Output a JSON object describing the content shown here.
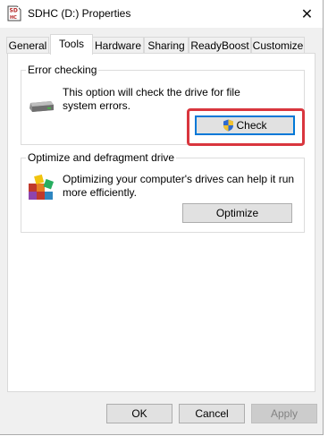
{
  "window": {
    "title": "SDHC (D:) Properties",
    "close_glyph": "✕",
    "icon": "sd-card-icon"
  },
  "tabs": [
    {
      "label": "General",
      "active": false
    },
    {
      "label": "Tools",
      "active": true
    },
    {
      "label": "Hardware",
      "active": false
    },
    {
      "label": "Sharing",
      "active": false
    },
    {
      "label": "ReadyBoost",
      "active": false
    },
    {
      "label": "Customize",
      "active": false
    }
  ],
  "error_checking": {
    "title": "Error checking",
    "description_line1": "This option will check the drive for file",
    "description_line2": "system errors.",
    "button_label": "Check",
    "icon": "drive-icon",
    "button_icon": "uac-shield-icon"
  },
  "optimize": {
    "title": "Optimize and defragment drive",
    "description_line1": "Optimizing your computer's drives can help it run",
    "description_line2": "more efficiently.",
    "button_label": "Optimize",
    "icon": "defrag-icon"
  },
  "footer": {
    "ok_label": "OK",
    "cancel_label": "Cancel",
    "apply_label": "Apply"
  },
  "colors": {
    "highlight": "#d9363e",
    "focus_border": "#0078d7"
  }
}
